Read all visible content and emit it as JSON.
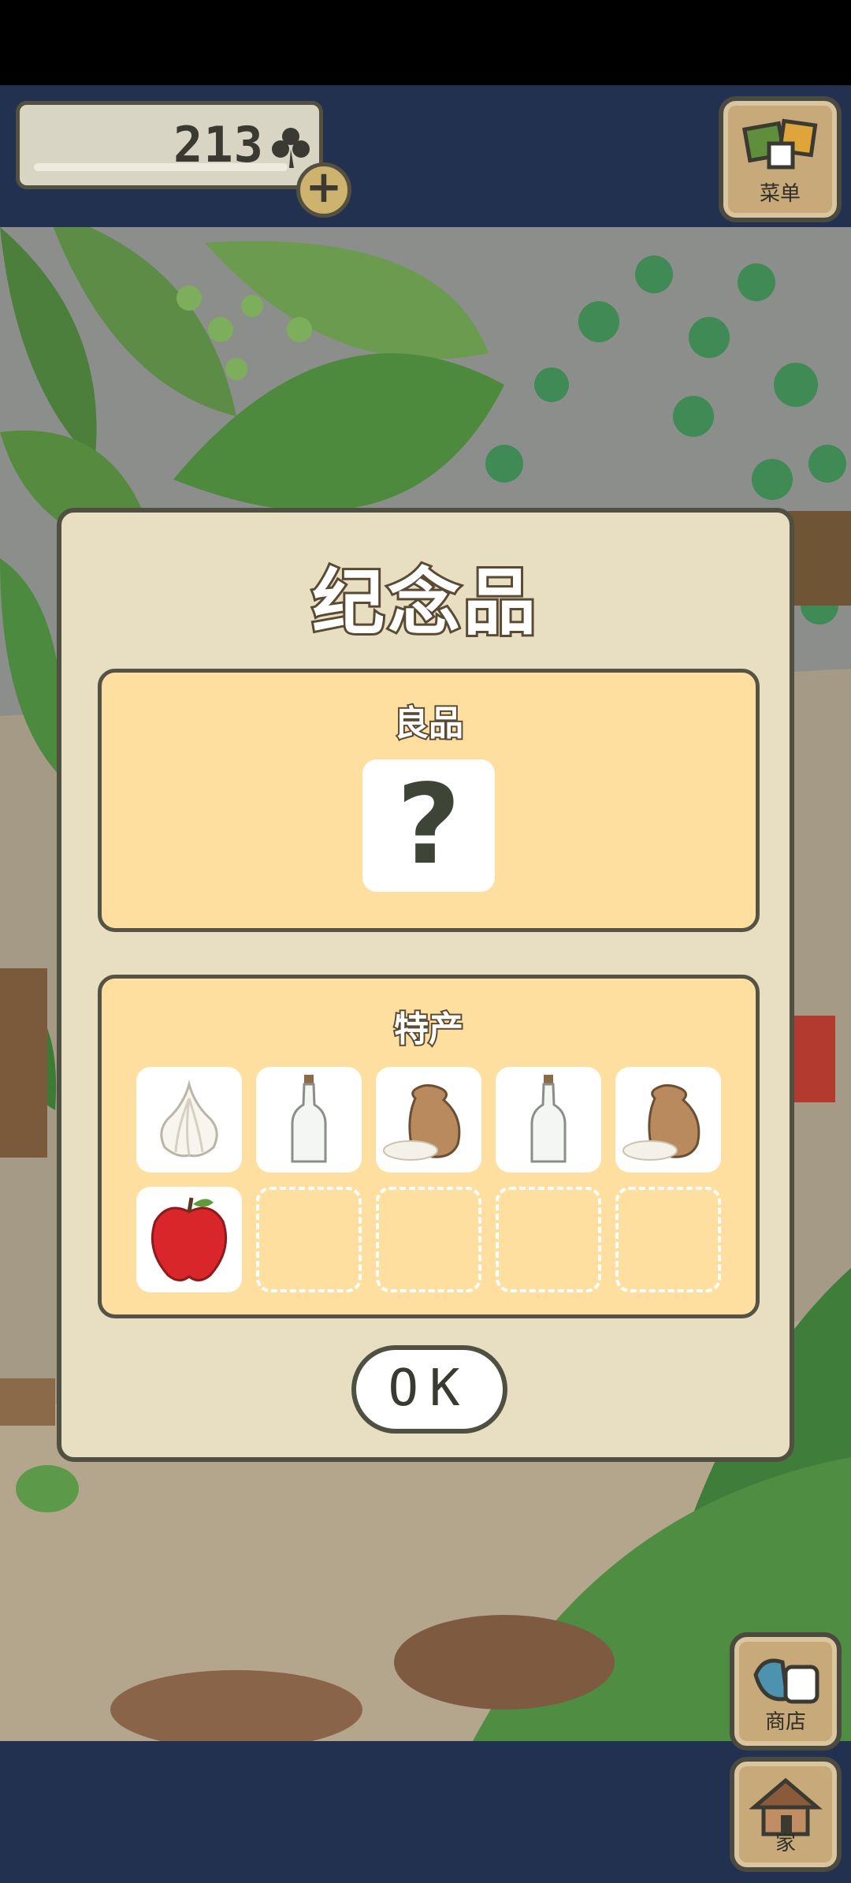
{
  "header": {
    "clover_count": "213",
    "clover_icon": "clover-icon",
    "add_icon": "+",
    "menu_label": "菜单"
  },
  "dialog": {
    "title": "纪念品",
    "good_items": {
      "label": "良品",
      "unknown_mark": "?"
    },
    "specialties": {
      "label": "特产",
      "slots": [
        {
          "item": "garlic",
          "filled": true
        },
        {
          "item": "glass-bottle",
          "filled": true
        },
        {
          "item": "rice-bag",
          "filled": true
        },
        {
          "item": "glass-bottle",
          "filled": true
        },
        {
          "item": "rice-bag",
          "filled": true
        },
        {
          "item": "apple",
          "filled": true
        },
        {
          "item": "",
          "filled": false
        },
        {
          "item": "",
          "filled": false
        },
        {
          "item": "",
          "filled": false
        },
        {
          "item": "",
          "filled": false
        }
      ]
    },
    "ok_label": "OK"
  },
  "side_buttons": {
    "shop_label": "商店",
    "home_label": "家"
  },
  "colors": {
    "navy_bar": "#22314f",
    "dialog_bg": "#e8dfc2",
    "panel_bg": "#ffdf9f",
    "outline": "#4f5041"
  }
}
